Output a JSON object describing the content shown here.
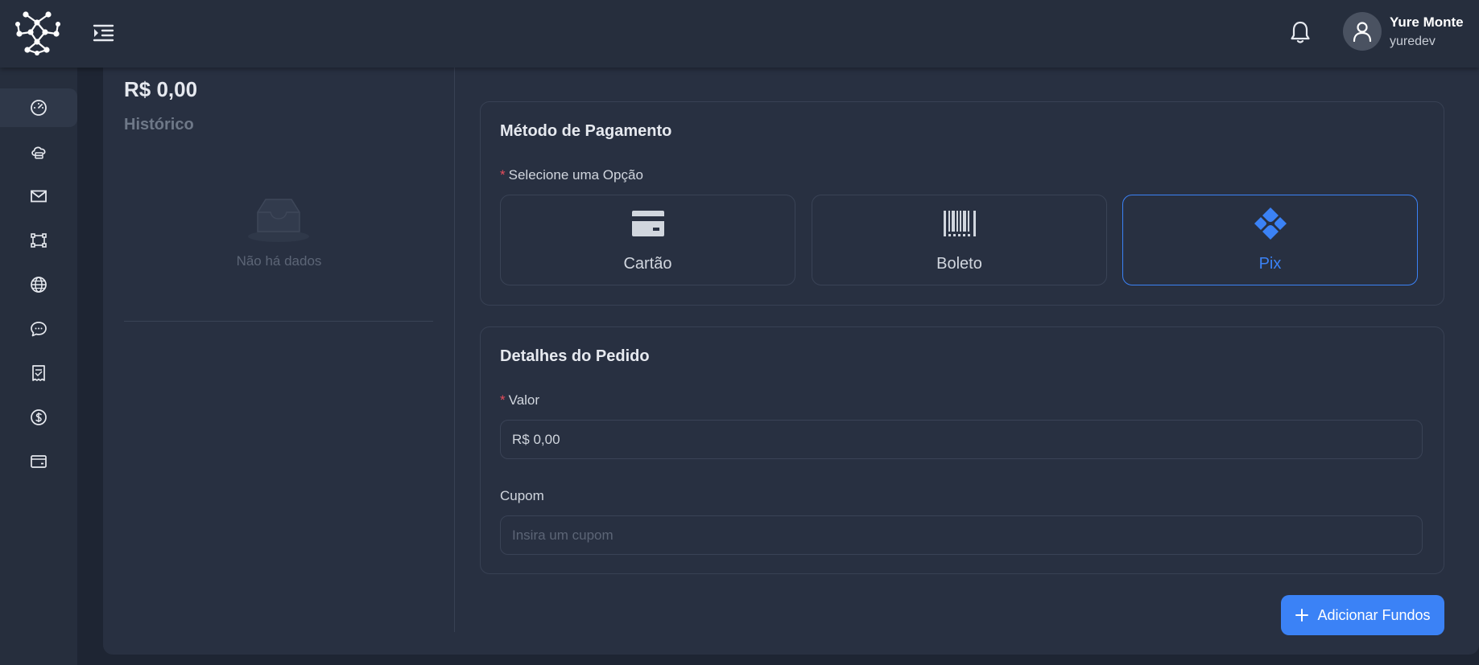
{
  "header": {
    "logo_icon": "network-logo-icon",
    "menu_icon": "menu-unfold-icon",
    "notification_icon": "bell-icon",
    "user": {
      "name": "Yure Monte",
      "handle": "yuredev",
      "avatar_icon": "user-icon"
    }
  },
  "sidebar": {
    "items": [
      {
        "icon": "dashboard-icon",
        "active": true
      },
      {
        "icon": "cloud-server-icon",
        "active": false
      },
      {
        "icon": "mail-icon",
        "active": false
      },
      {
        "icon": "nodes-icon",
        "active": false
      },
      {
        "icon": "globe-icon",
        "active": false
      },
      {
        "icon": "chat-icon",
        "active": false
      },
      {
        "icon": "receipt-icon",
        "active": false
      },
      {
        "icon": "dollar-icon",
        "active": false
      },
      {
        "icon": "wallet-icon",
        "active": false
      }
    ]
  },
  "summary": {
    "balance": "R$ 0,00",
    "history_title": "Histórico",
    "empty_text": "Não há dados"
  },
  "payment": {
    "title": "Método de Pagamento",
    "required_mark": "*",
    "select_label": "Selecione uma Opção",
    "options": [
      {
        "label": "Cartão",
        "icon": "credit-card-icon",
        "selected": false
      },
      {
        "label": "Boleto",
        "icon": "barcode-icon",
        "selected": false
      },
      {
        "label": "Pix",
        "icon": "pix-icon",
        "selected": true
      }
    ]
  },
  "order": {
    "title": "Detalhes do Pedido",
    "required_mark": "*",
    "value_label": "Valor",
    "value": "R$ 0,00",
    "coupon_label": "Cupom",
    "coupon_placeholder": "Insira um cupom"
  },
  "actions": {
    "add_funds": "Adicionar Fundos"
  },
  "colors": {
    "accent": "#3b82f6",
    "required": "#e74c5b",
    "background": "#1e2533",
    "surface": "#283041"
  }
}
